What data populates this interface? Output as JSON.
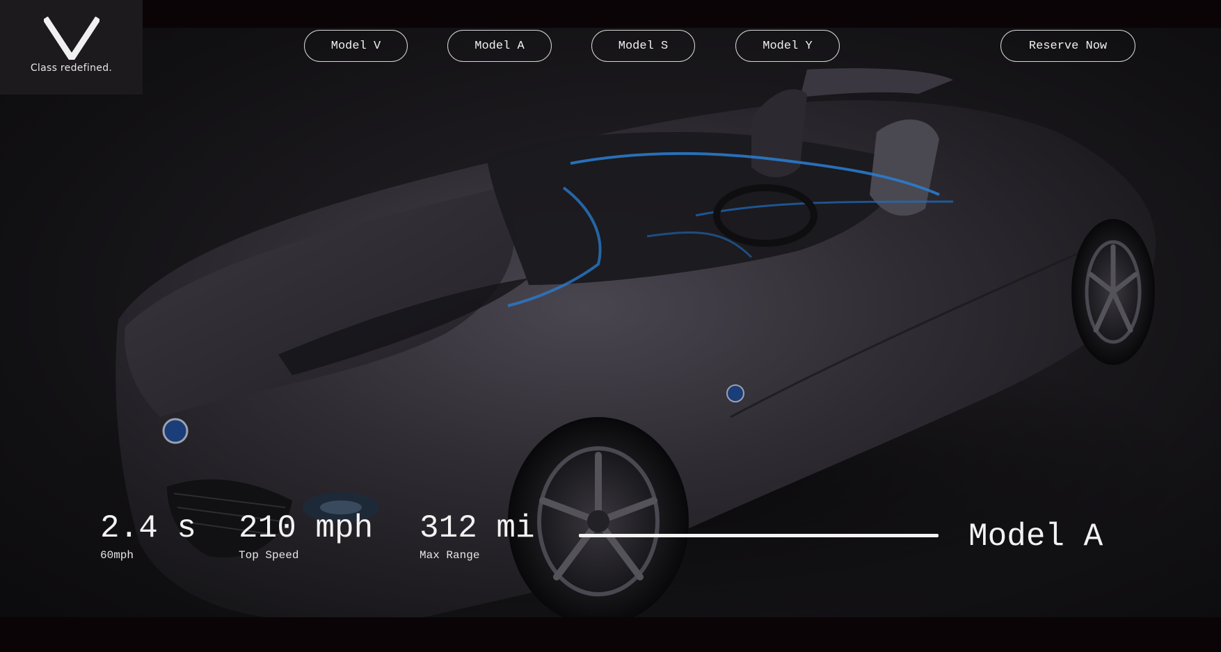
{
  "brand": {
    "logo_letter": "V",
    "tagline": "Class redefined."
  },
  "nav": {
    "items": [
      {
        "label": "Model V"
      },
      {
        "label": "Model A"
      },
      {
        "label": "Model S"
      },
      {
        "label": "Model Y"
      }
    ],
    "cta_label": "Reserve Now"
  },
  "stats": [
    {
      "value": "2.4 s",
      "label": "60mph"
    },
    {
      "value": "210 mph",
      "label": "Top Speed"
    },
    {
      "value": "312 mi",
      "label": "Max Range"
    }
  ],
  "current_model": "Model A",
  "colors": {
    "background": "#0a0406",
    "text": "#f2f2f2",
    "accent_glow": "#2a7fd4"
  },
  "icons": {
    "logo": "v-logo-icon"
  }
}
